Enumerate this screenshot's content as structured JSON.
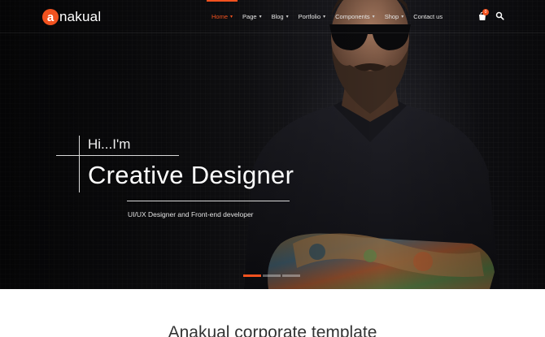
{
  "brand": {
    "logo_letter": "a",
    "logo_rest": "nakual",
    "accent": "#f2521f"
  },
  "nav": {
    "items": [
      {
        "label": "Home",
        "has_caret": true,
        "active": true
      },
      {
        "label": "Page",
        "has_caret": true,
        "active": false
      },
      {
        "label": "Blog",
        "has_caret": true,
        "active": false
      },
      {
        "label": "Portfolio",
        "has_caret": true,
        "active": false
      },
      {
        "label": "Components",
        "has_caret": true,
        "active": false
      },
      {
        "label": "Shop",
        "has_caret": true,
        "active": false
      },
      {
        "label": "Contact us",
        "has_caret": false,
        "active": false
      }
    ],
    "cart_icon": "shopping-bag-icon",
    "cart_count": "0",
    "search_icon": "search-icon"
  },
  "hero": {
    "greeting": "Hi...I'm",
    "headline": "Creative Designer",
    "subline": "UI/UX Designer and Front-end developer",
    "slides": 3,
    "active_slide": 1
  },
  "section": {
    "title": "Anakual corporate template"
  }
}
